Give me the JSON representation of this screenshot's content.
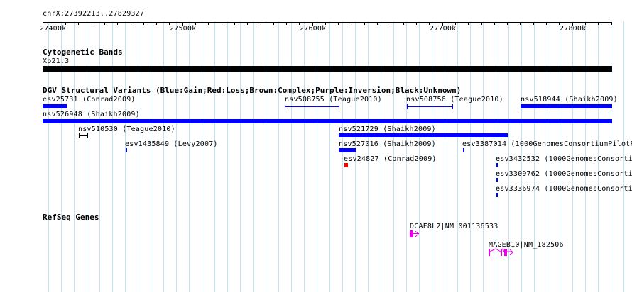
{
  "ruler": {
    "position_label": "chrX:27392213..27829327",
    "ticks": [
      "27400k",
      "27500k",
      "27600k",
      "27700k",
      "27800k"
    ]
  },
  "tracks": {
    "cytoband": {
      "title": "Cytogenetic Bands",
      "band_label": "Xp21.3",
      "band_color": "#000000"
    },
    "dgv": {
      "title": "DGV Structural Variants (Blue:Gain;Red:Loss;Brown:Complex;Purple:Inversion;Black:Unknown)",
      "gain_color": "#0000ff",
      "loss_color": "#ff0000",
      "features": [
        {
          "label": "esv25731 (Conrad2009)",
          "type": "gain"
        },
        {
          "label": "nsv508755 (Teague2010)",
          "type": "gain"
        },
        {
          "label": "nsv508756 (Teague2010)",
          "type": "gain"
        },
        {
          "label": "nsv518944 (Shaikh2009)",
          "type": "gain"
        },
        {
          "label": "nsv526948 (Shaikh2009)",
          "type": "gain"
        },
        {
          "label": "nsv510530 (Teague2010)",
          "type": "unknown"
        },
        {
          "label": "nsv521729 (Shaikh2009)",
          "type": "gain"
        },
        {
          "label": "esv1435849 (Levy2007)",
          "type": "gain"
        },
        {
          "label": "nsv527016 (Shaikh2009)",
          "type": "gain"
        },
        {
          "label": "esv3387014 (1000GenomesConsortiumPilotPr",
          "type": "gain"
        },
        {
          "label": "esv24827 (Conrad2009)",
          "type": "loss"
        },
        {
          "label": "esv3432532 (1000GenomesConsortiu",
          "type": "gain"
        },
        {
          "label": "esv3309762 (1000GenomesConsortiu",
          "type": "gain"
        },
        {
          "label": "esv3336974 (1000GenomesConsortiu",
          "type": "gain"
        }
      ]
    },
    "refseq": {
      "title": "RefSeq Genes",
      "gene_color": "#e600e6",
      "genes": [
        {
          "label": "DCAF8L2|NM_001136533"
        },
        {
          "label": "MAGEB10|NM_182506"
        }
      ]
    }
  }
}
